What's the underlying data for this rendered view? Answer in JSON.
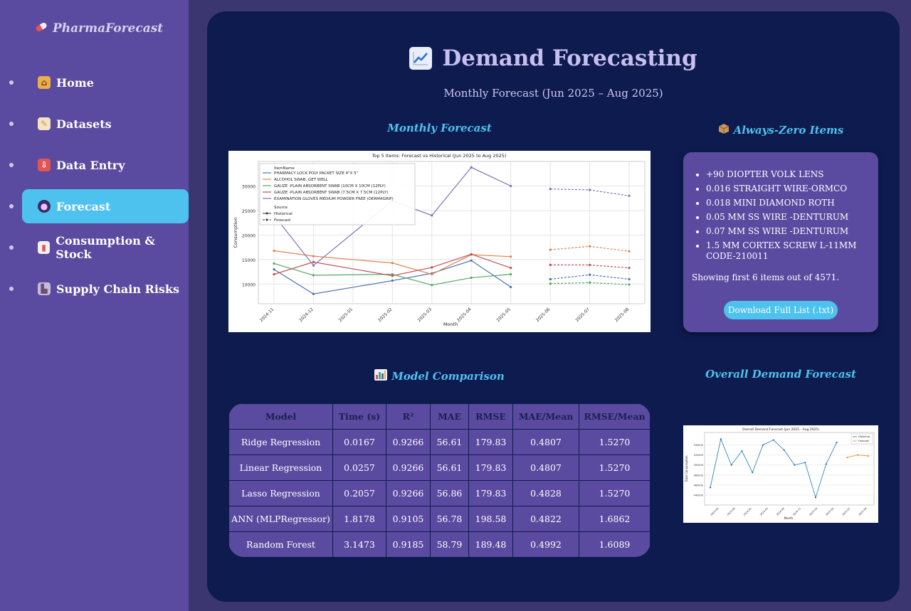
{
  "app": {
    "brand": "PharmaForecast",
    "brand_icon": "pill-icon"
  },
  "nav": [
    {
      "label": "Home",
      "icon": "house-icon",
      "active": false
    },
    {
      "label": "Datasets",
      "icon": "memo-icon",
      "active": false
    },
    {
      "label": "Data Entry",
      "icon": "inbox-tray-icon",
      "active": false
    },
    {
      "label": "Forecast",
      "icon": "crystal-ball-icon",
      "active": true
    },
    {
      "label": "Consumption & Stock",
      "icon": "bar-chart-icon",
      "active": false
    },
    {
      "label": "Supply Chain Risks",
      "icon": "factory-icon",
      "active": false
    }
  ],
  "page": {
    "title": "Demand Forecasting",
    "subtitle": "Monthly Forecast (Jun 2025 – Aug 2025)"
  },
  "sections": {
    "monthly": "Monthly Forecast",
    "zero": "Always-Zero Items",
    "model": "Model Comparison",
    "overall": "Overall Demand Forecast"
  },
  "zero_items": {
    "items": [
      "+90 DIOPTER VOLK LENS",
      "0.016 STRAIGHT WIRE-ORMCO",
      "0.018 MINI DIAMOND ROTH",
      "0.05 MM SS WIRE -DENTURUM",
      "0.07 MM SS WIRE -DENTURUM",
      "1.5 MM CORTEX SCREW L-11MM CODE-210011"
    ],
    "note": "Showing first 6 items out of 4571.",
    "download_label": "Download Full List (.txt)"
  },
  "model_table": {
    "headers": [
      "Model",
      "Time (s)",
      "R²",
      "MAE",
      "RMSE",
      "MAE/Mean",
      "RMSE/Mean"
    ],
    "rows": [
      [
        "Ridge Regression",
        "0.0167",
        "0.9266",
        "56.61",
        "179.83",
        "0.4807",
        "1.5270"
      ],
      [
        "Linear Regression",
        "0.0257",
        "0.9266",
        "56.61",
        "179.83",
        "0.4807",
        "1.5270"
      ],
      [
        "Lasso Regression",
        "0.2057",
        "0.9266",
        "56.86",
        "179.83",
        "0.4828",
        "1.5270"
      ],
      [
        "ANN (MLPRegressor)",
        "1.8178",
        "0.9105",
        "56.78",
        "198.58",
        "0.4822",
        "1.6862"
      ],
      [
        "Random Forest",
        "3.1473",
        "0.9185",
        "58.79",
        "189.48",
        "0.4992",
        "1.6089"
      ]
    ]
  },
  "chart_data": [
    {
      "type": "line",
      "title": "Top 5 Items: Forecast vs Historical (Jun 2025 to Aug 2025)",
      "xlabel": "Month",
      "ylabel": "Consumption",
      "categories": [
        "2024-11",
        "2024-12",
        "2025-01",
        "2025-02",
        "2025-03",
        "2025-04",
        "2025-05",
        "2025-06",
        "2025-07",
        "2025-08"
      ],
      "ylim": [
        6000,
        35000
      ],
      "yticks": [
        10000,
        15000,
        20000,
        25000,
        30000
      ],
      "legend_title": "ItemName",
      "legend_source_title": "Source",
      "legend_source": [
        "Historical",
        "Forecast"
      ],
      "series": [
        {
          "name": "PHARMACY LOCK POLY PACKET SIZE 4\"X 5\"",
          "color": "#4c72b0",
          "x": [
            "2024-11",
            "2024-12",
            "2025-02",
            "2025-03",
            "2025-04",
            "2025-05"
          ],
          "values": [
            13000,
            8000,
            10700,
            12200,
            14800,
            9400
          ],
          "fx": [
            "2025-06",
            "2025-07",
            "2025-08"
          ],
          "fvalues": [
            11000,
            11900,
            11000
          ]
        },
        {
          "name": "ALCOHOL SWAB, GET WELL",
          "color": "#dd8452",
          "x": [
            "2024-11",
            "2024-12",
            "2025-02",
            "2025-03",
            "2025-04",
            "2025-05"
          ],
          "values": [
            16800,
            15700,
            14300,
            12000,
            16000,
            15600
          ],
          "fx": [
            "2025-06",
            "2025-07",
            "2025-08"
          ],
          "fvalues": [
            17000,
            17700,
            16700
          ]
        },
        {
          "name": "GAUZE -PLAIN ABSORBENT SWAB (10CM X 10CM (12PLY)",
          "color": "#55a868",
          "x": [
            "2024-11",
            "2024-12",
            "2025-02",
            "2025-03",
            "2025-04",
            "2025-05"
          ],
          "values": [
            14200,
            11800,
            12000,
            9800,
            11300,
            12000
          ],
          "fx": [
            "2025-06",
            "2025-07",
            "2025-08"
          ],
          "fvalues": [
            10100,
            10300,
            9900
          ]
        },
        {
          "name": "GAUZE -PLAIN ABSORBENT SWAB (7.5CM X 7.5CM (12PLY)",
          "color": "#c44e52",
          "x": [
            "2024-11",
            "2024-12",
            "2025-02",
            "2025-03",
            "2025-04",
            "2025-05"
          ],
          "values": [
            12000,
            14500,
            11700,
            13400,
            16100,
            13300
          ],
          "fx": [
            "2025-06",
            "2025-07",
            "2025-08"
          ],
          "fvalues": [
            13900,
            13900,
            13300
          ]
        },
        {
          "name": "EXAMINATION GLOVES MEDIUM POWDER FREE (DERMAGRIP)",
          "color": "#8172b3",
          "x": [
            "2024-11",
            "2024-12",
            "2025-02",
            "2025-03",
            "2025-04",
            "2025-05"
          ],
          "values": [
            24000,
            13800,
            27000,
            24000,
            33800,
            30000
          ],
          "fx": [
            "2025-06",
            "2025-07",
            "2025-08"
          ],
          "fvalues": [
            29400,
            29200,
            28000
          ]
        }
      ]
    },
    {
      "type": "line",
      "title": "Overall Demand Forecast (Jun 2025 - Aug 2025)",
      "xlabel": "Month",
      "ylabel": "Total Consumption",
      "legend": [
        "Historical",
        "Forecast"
      ],
      "ylim": [
        420000,
        565000
      ],
      "yticks": [
        440000,
        460000,
        480000,
        500000,
        520000,
        540000
      ],
      "xticks": [
        "2023-05",
        "2023-09",
        "2024-01",
        "2024-05",
        "2024-09",
        "2024-11",
        "2025-03",
        "2025-05",
        "2025-07",
        "2025-09"
      ],
      "series": [
        {
          "name": "Historical",
          "color": "#1f77b4",
          "values": [
            455000,
            552000,
            500000,
            528000,
            485000,
            540000,
            550000,
            530000,
            500000,
            505000,
            435000,
            502000,
            545000
          ]
        },
        {
          "name": "Forecast",
          "color": "#ff7f0e",
          "values": [
            515000,
            520000,
            518000
          ]
        }
      ]
    }
  ]
}
